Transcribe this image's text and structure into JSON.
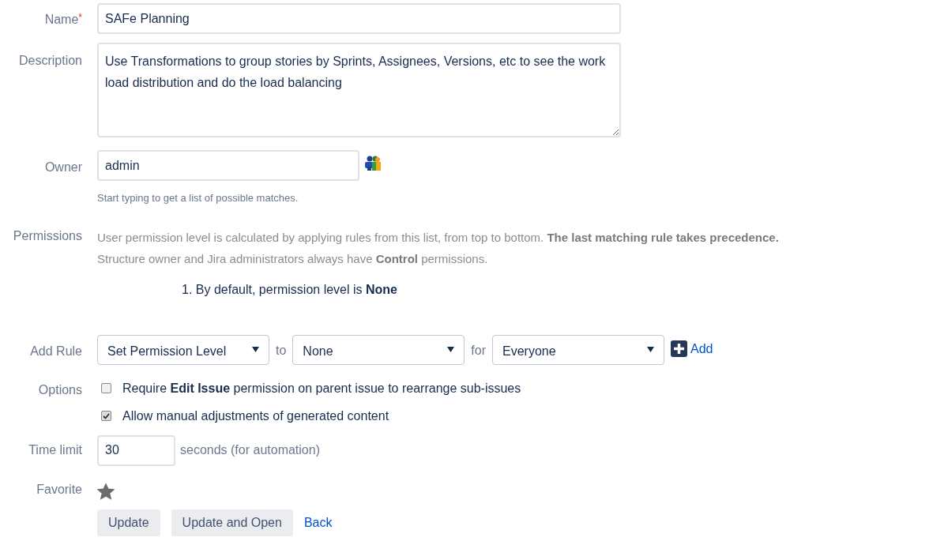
{
  "name": {
    "label": "Name",
    "required_mark": "*",
    "value": "SAFe Planning"
  },
  "description": {
    "label": "Description",
    "value": "Use Transformations to group stories by Sprints, Assignees, Versions, etc to see the work load distribution and do the load balancing"
  },
  "owner": {
    "label": "Owner",
    "value": "admin",
    "hint": "Start typing to get a list of possible matches."
  },
  "permissions": {
    "label": "Permissions",
    "lines": [
      "User permission level is calculated by applying rules from this list, from top to bottom. **The last matching rule takes precedence.**",
      "Structure owner and Jira administrators always have **Control** permissions."
    ],
    "rules": [
      "1. By default, permission level is **None**"
    ]
  },
  "add_rule": {
    "label": "Add Rule",
    "action": "Set Permission Level",
    "to_label": "to",
    "level": "None",
    "for_label": "for",
    "who": "Everyone",
    "add_link": "Add"
  },
  "options": {
    "label": "Options",
    "items": [
      {
        "text": "Require **Edit Issue** permission on parent issue to rearrange sub-issues",
        "checked": false
      },
      {
        "text": "Allow manual adjustments of generated content",
        "checked": true
      }
    ]
  },
  "time_limit": {
    "label": "Time limit",
    "value": "30",
    "suffix": "seconds (for automation)"
  },
  "favorite": {
    "label": "Favorite",
    "on": true
  },
  "buttons": [
    "Update",
    "Update and Open"
  ],
  "back_link": "Back"
}
